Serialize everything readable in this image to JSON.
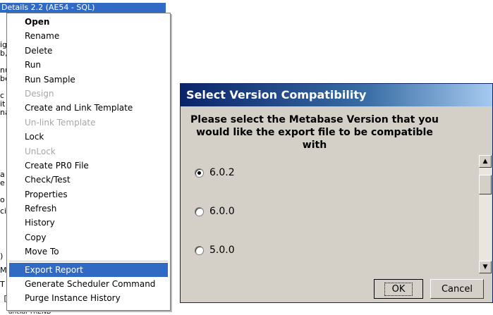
{
  "tree": {
    "header_text": "Details 2.2 (AE54 - SQL)",
    "fragments": [
      "ig",
      "b,",
      "nu",
      "be",
      "c",
      "it",
      "na",
      "a",
      "e",
      "o",
      "ci",
      ")",
      "M",
      "T",
      "_["
    ],
    "footer_text": "ancial TREND"
  },
  "context_menu": {
    "items": [
      {
        "label": "Open",
        "bold": true,
        "disabled": false,
        "highlighted": false
      },
      {
        "label": "Rename",
        "bold": false,
        "disabled": false,
        "highlighted": false
      },
      {
        "label": "Delete",
        "bold": false,
        "disabled": false,
        "highlighted": false
      },
      {
        "label": "Run",
        "bold": false,
        "disabled": false,
        "highlighted": false
      },
      {
        "label": "Run Sample",
        "bold": false,
        "disabled": false,
        "highlighted": false
      },
      {
        "label": "Design",
        "bold": false,
        "disabled": true,
        "highlighted": false
      },
      {
        "label": "Create and Link Template",
        "bold": false,
        "disabled": false,
        "highlighted": false
      },
      {
        "label": "Un-link Template",
        "bold": false,
        "disabled": true,
        "highlighted": false
      },
      {
        "label": "Lock",
        "bold": false,
        "disabled": false,
        "highlighted": false
      },
      {
        "label": "UnLock",
        "bold": false,
        "disabled": true,
        "highlighted": false
      },
      {
        "label": "Create PR0 File",
        "bold": false,
        "disabled": false,
        "highlighted": false
      },
      {
        "label": "Check/Test",
        "bold": false,
        "disabled": false,
        "highlighted": false
      },
      {
        "label": "Properties",
        "bold": false,
        "disabled": false,
        "highlighted": false
      },
      {
        "label": "Refresh",
        "bold": false,
        "disabled": false,
        "highlighted": false
      },
      {
        "label": "History",
        "bold": false,
        "disabled": false,
        "highlighted": false
      },
      {
        "label": "Copy",
        "bold": false,
        "disabled": false,
        "highlighted": false
      },
      {
        "label": "Move To",
        "bold": false,
        "disabled": false,
        "highlighted": false
      },
      {
        "label": "Export Report",
        "bold": false,
        "disabled": false,
        "highlighted": true
      },
      {
        "label": "Generate Scheduler Command",
        "bold": false,
        "disabled": false,
        "highlighted": false
      },
      {
        "label": "Purge Instance History",
        "bold": false,
        "disabled": false,
        "highlighted": false
      }
    ]
  },
  "dialog": {
    "title": "Select Version Compatibility",
    "prompt": "Please select the Metabase Version that you would like the export file to be compatible with",
    "options": [
      {
        "label": "6.0.2",
        "checked": true
      },
      {
        "label": "6.0.0",
        "checked": false
      },
      {
        "label": "5.0.0",
        "checked": false
      }
    ],
    "ok_label": "OK",
    "cancel_label": "Cancel"
  },
  "colors": {
    "menu_highlight": "#316ac5",
    "title_gradient_start": "#0a246a",
    "title_gradient_end": "#a6caf0",
    "dialog_face": "#d4d0c8"
  }
}
